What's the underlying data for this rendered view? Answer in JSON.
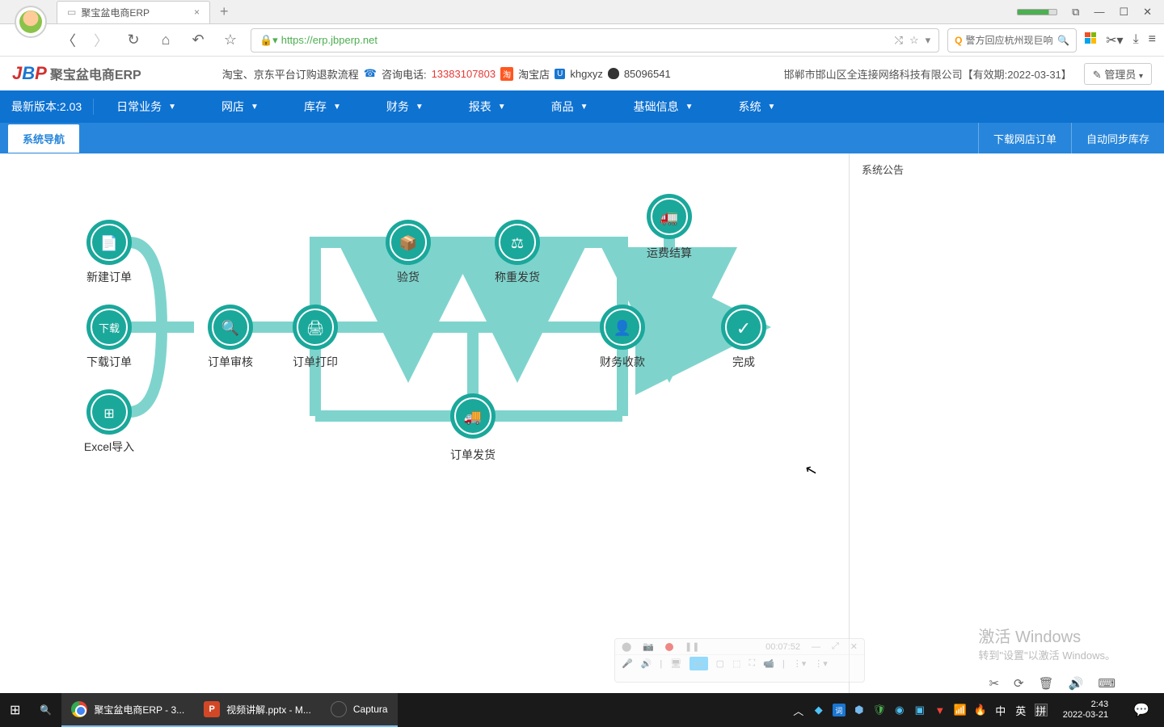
{
  "browser": {
    "tab_title": "聚宝盆电商ERP",
    "url_prefix": "https://",
    "url": "erp.jbperp.net",
    "search_placeholder": "警方回应杭州现巨响"
  },
  "header": {
    "logo_text": "聚宝盆电商ERP",
    "links_text": "淘宝、京东平台订购退款流程",
    "phone_label": "咨询电话:",
    "phone": "13383107803",
    "taobao": "淘宝店",
    "kh": "khgxyz",
    "qq": "85096541",
    "company": "邯郸市邯山区全连接网络科技有限公司【有效期:2022-03-31】",
    "admin": "管理员"
  },
  "menu": {
    "version": "最新版本:2.03",
    "items": [
      "日常业务",
      "网店",
      "库存",
      "财务",
      "报表",
      "商品",
      "基础信息",
      "系统"
    ]
  },
  "subbar": {
    "tab": "系统导航",
    "btn1": "下载网店订单",
    "btn2": "自动同步库存"
  },
  "announce": {
    "title": "系统公告"
  },
  "flow": {
    "new_order": "新建订单",
    "download_order": "下载订单",
    "download_btn": "下载",
    "excel_import": "Excel导入",
    "order_audit": "订单审核",
    "order_print": "订单打印",
    "inspect": "验货",
    "weigh_ship": "称重发货",
    "order_ship": "订单发货",
    "finance_collect": "财务收款",
    "freight_settle": "运费结算",
    "complete": "完成"
  },
  "recorder": {
    "time": "00:07:52"
  },
  "activate": {
    "title": "激活 Windows",
    "sub": "转到\"设置\"以激活 Windows。"
  },
  "taskbar": {
    "app1": "聚宝盆电商ERP - 3...",
    "app2": "视频讲解.pptx - M...",
    "app3": "Captura",
    "ime1": "中",
    "ime2": "英",
    "ime3": "拼",
    "time": "2:43",
    "date": "2022-03-21"
  }
}
